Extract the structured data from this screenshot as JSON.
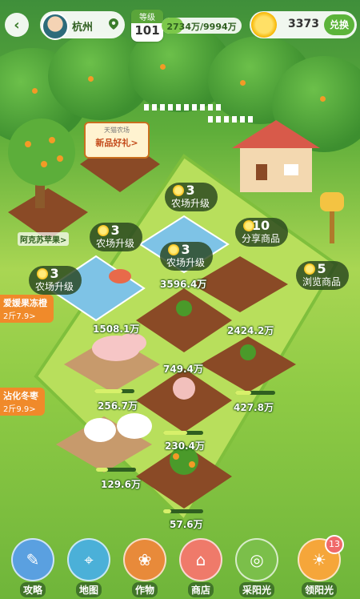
{
  "topbar": {
    "back_icon": "chevron-left-icon",
    "city": "杭州",
    "level_label": "等级",
    "level_value": "101",
    "exp_text": "2734万/9994万",
    "exp_progress": 0.27,
    "sun_count": "3373",
    "redeem_label": "兑换"
  },
  "farm": {
    "sign_top": "天猫农场",
    "sign_main": "新品好礼>",
    "tree_label": "阿克苏苹果>",
    "house_icon": "farmhouse-icon",
    "mailbox_icon": "mailbox-icon"
  },
  "bubbles": [
    {
      "num": "3",
      "text": "农场升级"
    },
    {
      "num": "3",
      "text": "农场升级"
    },
    {
      "num": "3",
      "text": "农场升级"
    },
    {
      "num": "3",
      "text": "农场升级"
    },
    {
      "num": "10",
      "text": "分享商品"
    },
    {
      "num": "5",
      "text": "浏览商品"
    }
  ],
  "amounts": {
    "a1": "3596.4万",
    "a2": "1508.1万",
    "a3": "2424.2万",
    "a4": "749.4万",
    "a5": "256.7万",
    "a6": "427.8万",
    "a7": "230.4万",
    "a8": "129.6万",
    "a9": "57.6万"
  },
  "side_tags": [
    {
      "name": "爱媛果冻橙",
      "price": "2斤7.9>"
    },
    {
      "name": "沾化冬枣",
      "price": "2斤9.9>"
    }
  ],
  "nav": [
    {
      "label": "攻略",
      "icon": "guide-book-icon",
      "color": "#5aa0e0"
    },
    {
      "label": "地图",
      "icon": "map-icon",
      "color": "#4bb0d8"
    },
    {
      "label": "作物",
      "icon": "crop-book-icon",
      "color": "#e88a3a"
    },
    {
      "label": "商店",
      "icon": "shop-icon",
      "color": "#ef7a6a"
    },
    {
      "label": "采阳光",
      "icon": "sun-catch-icon",
      "color": "#7bbf4a"
    },
    {
      "label": "领阳光",
      "icon": "sun-icon",
      "color": "#f5a63a",
      "badge": "13"
    }
  ]
}
